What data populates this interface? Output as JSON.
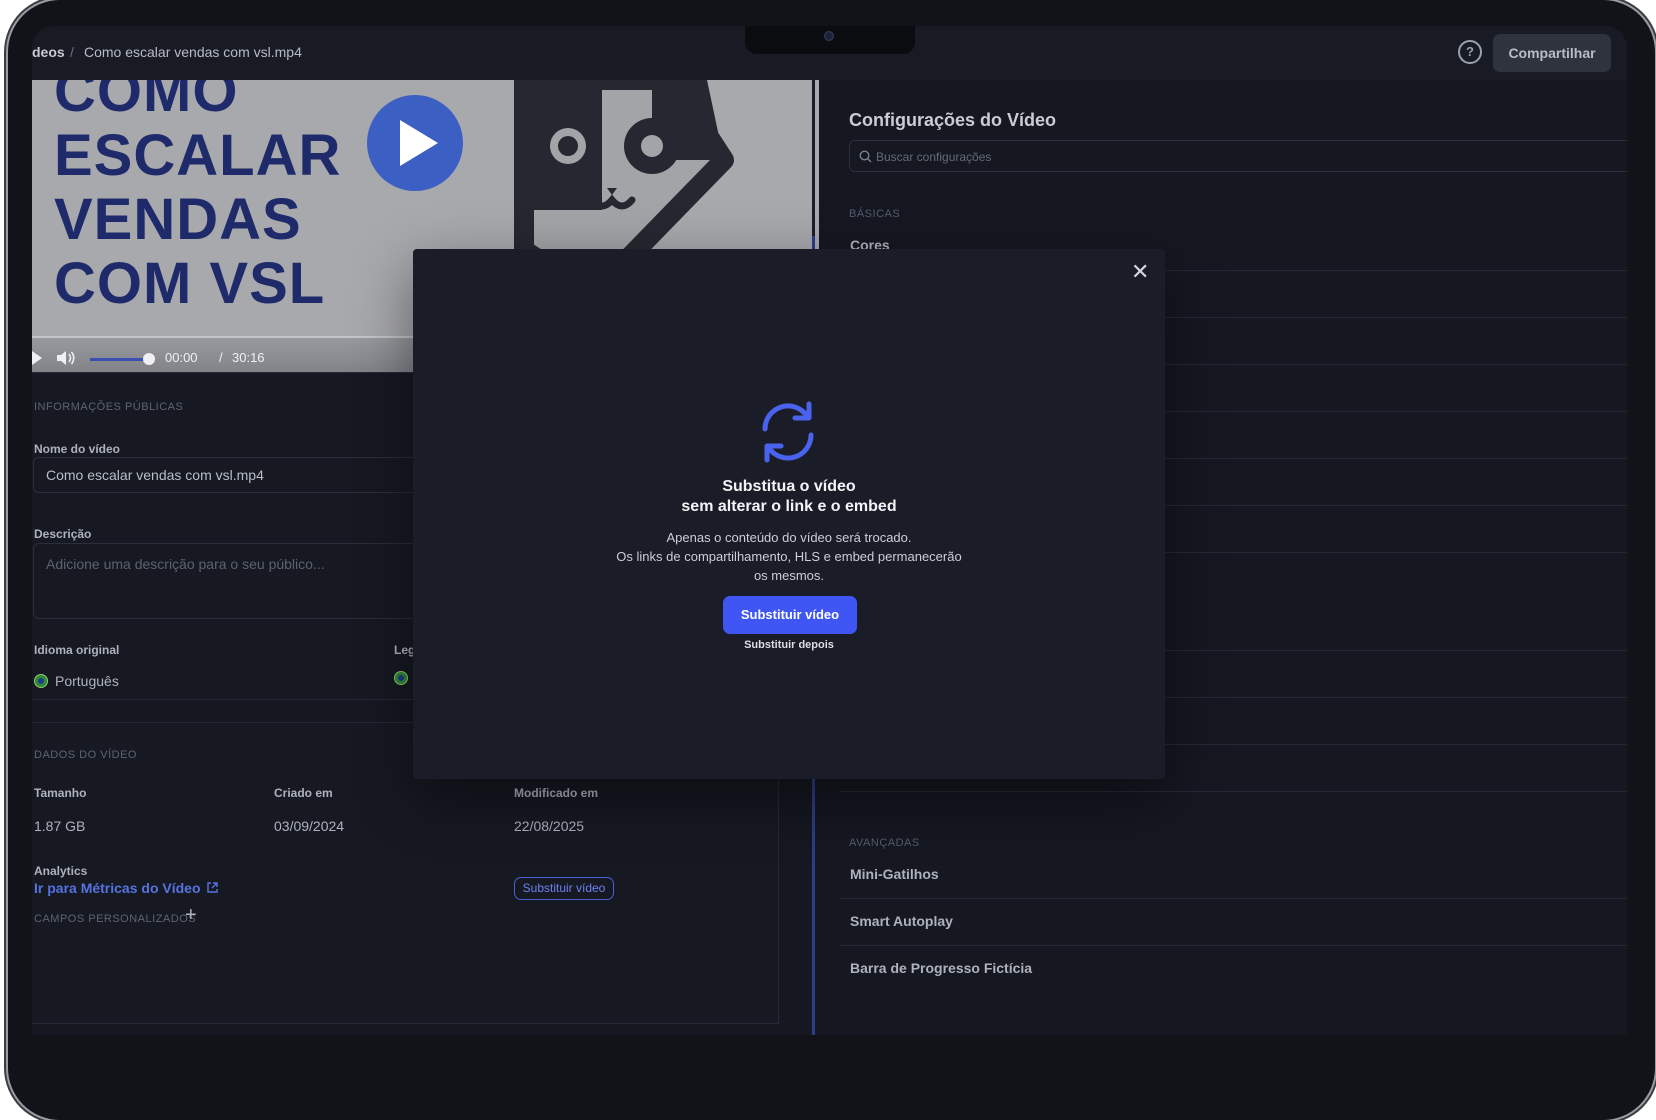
{
  "topbar": {
    "crumb_prev": "deos",
    "crumb_sep": "/",
    "crumb_current": "Como escalar vendas com vsl.mp4",
    "help_icon": "?",
    "share_label": "Compartilhar"
  },
  "video": {
    "title_lines": [
      "COMO",
      "ESCALAR",
      "VENDAS",
      "COM VSL"
    ],
    "current_time": "00:00",
    "time_sep": "/",
    "duration": "30:16"
  },
  "public_info": {
    "section_label": "INFORMAÇÕES PÚBLICAS",
    "name_label": "Nome do vídeo",
    "name_value": "Como escalar vendas com vsl.mp4",
    "desc_label": "Descrição",
    "desc_placeholder": "Adicione uma descrição para o seu público...",
    "lang_label": "Idioma original",
    "lang_value": "Português",
    "subs_label": "Leg"
  },
  "video_data": {
    "section_label": "DADOS DO VÍDEO",
    "size_label": "Tamanho",
    "size_value": "1.87 GB",
    "created_label": "Criado em",
    "created_value": "03/09/2024",
    "modified_label": "Modificado em",
    "modified_value": "22/08/2025",
    "analytics_label": "Analytics",
    "analytics_link": "Ir para Métricas do Vídeo",
    "replace_button": "Substituir vídeo",
    "custom_fields_label": "CAMPOS PERSONALIZADOS",
    "add_icon": "+"
  },
  "settings": {
    "title": "Configurações do Vídeo",
    "search_placeholder": "Buscar configurações",
    "basic_label": "BÁSICAS",
    "basic_items": [
      "Cores"
    ],
    "advanced_label": "AVANÇADAS",
    "advanced_items": [
      "Mini-Gatilhos",
      "Smart Autoplay",
      "Barra de Progresso Fictícia"
    ]
  },
  "modal": {
    "close_icon": "✕",
    "title_line1": "Substitua o vídeo",
    "title_line2": "sem alterar o link e o embed",
    "text_line1": "Apenas o conteúdo do vídeo será trocado.",
    "text_line2": "Os links de compartilhamento, HLS e embed permanecerão",
    "text_line3": "os mesmos.",
    "primary_button": "Substituir vídeo",
    "secondary_link": "Substituir depois",
    "accent_color": "#3f56f5"
  }
}
